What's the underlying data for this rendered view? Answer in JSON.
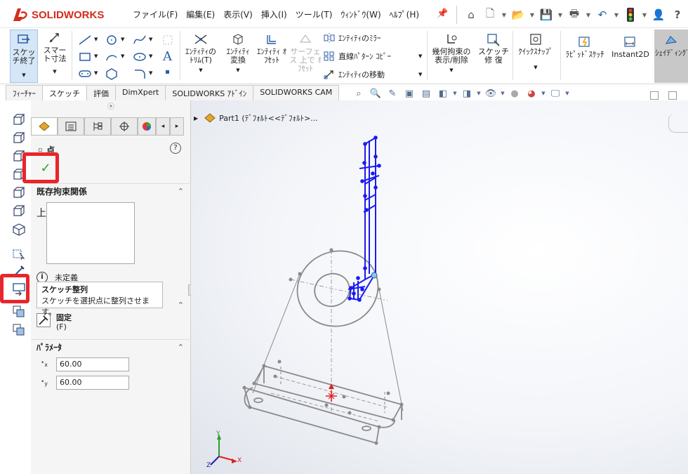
{
  "app": {
    "name": "SOLIDWORKS"
  },
  "menu": [
    "ファイル(F)",
    "編集(E)",
    "表示(V)",
    "挿入(I)",
    "ツール(T)",
    "ｳｨﾝﾄﾞｳ(W)",
    "ﾍﾙﾌﾟ(H)"
  ],
  "ribbon": {
    "exit_sketch": "スケッチ終了",
    "smart_dim": "スマート寸法",
    "trim": "ｴﾝﾃｨﾃｨの ﾄﾘﾑ(T)",
    "convert": "ｴﾝﾃｨﾃｨ 変換",
    "offset": "ｴﾝﾃｨﾃｨ ｵﾌｾｯﾄ",
    "surface_offset": "サーフェス 上で ｵﾌｾｯﾄ",
    "mirror": "ｴﾝﾃｨﾃｨのﾐﾗｰ",
    "linear_pattern": "直線ﾊﾟﾀｰﾝ ｺﾋﾟｰ",
    "move": "ｴﾝﾃｨﾃｨの移動",
    "relations": "幾何拘束の 表示/削除",
    "repair": "スケッチ修 復",
    "quick_snap": "ｸｲｯｸｽﾅｯﾌﾟ",
    "rapid_sketch": "ﾗﾋﾟｯﾄﾞｽｹｯﾁ",
    "instant2d": "Instant2D",
    "shaded": "ｼｪｲﾃﾞｨﾝｸﾞ スケッチ輪 郭"
  },
  "tabs": [
    "ﾌｨｰﾁｬｰ",
    "スケッチ",
    "評価",
    "DimXpert",
    "SOLIDWORKS ｱﾄﾞｲﾝ",
    "SOLIDWORKS CAM"
  ],
  "active_tab": "スケッチ",
  "tree": {
    "part": "Part1 (ﾃﾞﾌｫﾙﾄ<<ﾃﾞﾌｫﾙﾄ>..."
  },
  "property_manager": {
    "title": "点",
    "existing_relations_header": "既存拘束関係",
    "relation_symbol": "上",
    "status": "未定義",
    "fix_label": "固定",
    "fix_shortcut": "(F)",
    "params_header": "ﾊﾟﾗﾒｰﾀ",
    "x_value": "60.00",
    "y_value": "60.00"
  },
  "tooltip": {
    "title": "スケッチ整列",
    "description": "スケッチを選択点に整列させます。"
  },
  "axis": {
    "x": "X",
    "y": "Y",
    "z": "Z"
  },
  "colors": {
    "sketch_blue": "#1a1af0",
    "highlight_red": "#e8262b",
    "accent_green": "#2e9e2e"
  }
}
